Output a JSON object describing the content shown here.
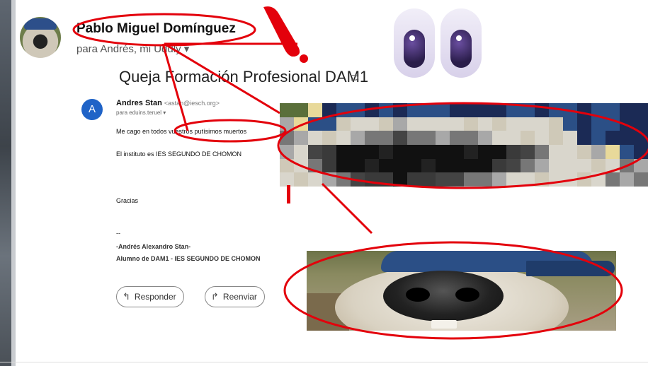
{
  "email": {
    "sender_name": "Pablo Miguel Domínguez",
    "recipients": "para Andrés, mi Uddly ▾",
    "subject": "Queja Formación Profesional DAM1",
    "subject_icon": "label-icon",
    "inner": {
      "avatar_letter": "A",
      "name": "Andres Stan",
      "email": "<astan@iesch.org>",
      "to": "para eduins.teruel ▾",
      "line1": "Me cago en todos vuestros putísimos muertos",
      "line2": "El instituto es IES SEGUNDO DE CHOMON",
      "closing": "Gracias",
      "sig_dash": "--",
      "sig_name": "-Andrés Alexandro Stan-",
      "sig_role": "Alumno de DAM1 - IES SEGUNDO DE CHOMON"
    },
    "buttons": {
      "reply_label": "Responder",
      "forward_label": "Reenviar"
    }
  },
  "colors": {
    "annotation_red": "#e3000b",
    "avatar_blue": "#1f63c7"
  },
  "overlays": {
    "emoji": "eyes-emoji",
    "pixelated_image": "pixelated-dog-photo",
    "dog_image": "dog-nose-closeup-photo"
  }
}
